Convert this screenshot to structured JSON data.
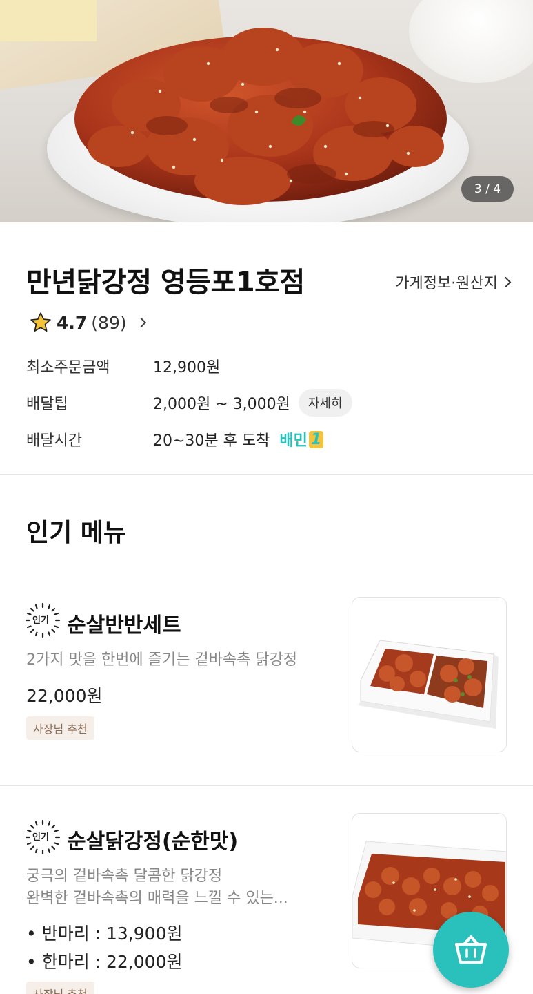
{
  "hero": {
    "pager": "3 / 4"
  },
  "store": {
    "name": "만년닭강정 영등포1호점",
    "info_link": "가게정보·원산지",
    "rating_score": "4.7",
    "rating_count": "(89)",
    "min_order_label": "최소주문금액",
    "min_order_value": "12,900원",
    "delivery_tip_label": "배달팁",
    "delivery_tip_value": "2,000원 ~ 3,000원",
    "delivery_tip_detail": "자세히",
    "delivery_time_label": "배달시간",
    "delivery_time_value": "20~30분 후 도착",
    "baemin1_label": "배민",
    "baemin1_number": "1"
  },
  "popular": {
    "title": "인기 메뉴",
    "badge_label": "인기",
    "items": [
      {
        "name": "순살반반세트",
        "description": "2가지 맛을 한번에 즐기는 겉바속촉 닭강정",
        "price": "22,000원",
        "tag": "사장님 추천"
      },
      {
        "name": "순살닭강정(순한맛)",
        "description_line1": "궁극의 겉바속촉 달콤한 닭강정",
        "description_line2": "완벽한 겉바속촉의 매력을 느낄 수 있는...",
        "price_half": "• 반마리 : 13,900원",
        "price_whole": "• 한마리 : 22,000원",
        "tag": "사장님 추천"
      }
    ]
  },
  "icons": {
    "cart": "basket-icon",
    "rating": "star-icon"
  },
  "colors": {
    "accent": "#2ac1bc",
    "star": "#f5c33b",
    "tag_bg": "#f6efe9"
  }
}
